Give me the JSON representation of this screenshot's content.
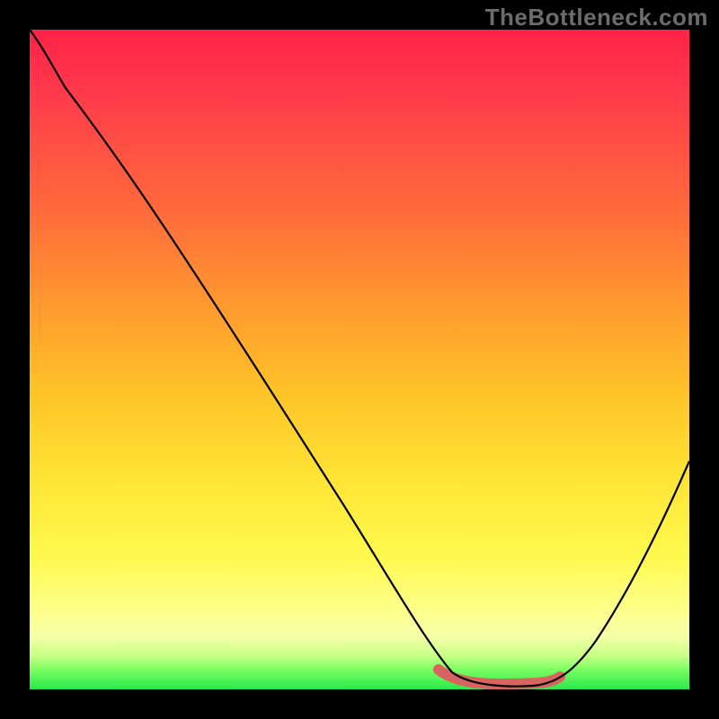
{
  "watermark": "TheBottleneck.com",
  "colors": {
    "background": "#000000",
    "gradient_top": "#ff2247",
    "gradient_mid": "#ffe435",
    "gradient_bottom": "#28e84a",
    "curve": "#000000",
    "highlight": "#d96361"
  },
  "chart_data": {
    "type": "line",
    "title": "",
    "xlabel": "",
    "ylabel": "",
    "xlim": [
      0,
      100
    ],
    "ylim": [
      0,
      100
    ],
    "series": [
      {
        "name": "bottleneck-curve",
        "x": [
          0,
          4,
          10,
          20,
          30,
          40,
          50,
          58,
          62,
          68,
          74,
          80,
          85,
          90,
          95,
          100
        ],
        "y": [
          100,
          96,
          90,
          77,
          63,
          49,
          35,
          22,
          12,
          3,
          1,
          1,
          3,
          12,
          25,
          40
        ]
      }
    ],
    "optimal_range_x": [
      62,
      80
    ],
    "annotations": []
  }
}
